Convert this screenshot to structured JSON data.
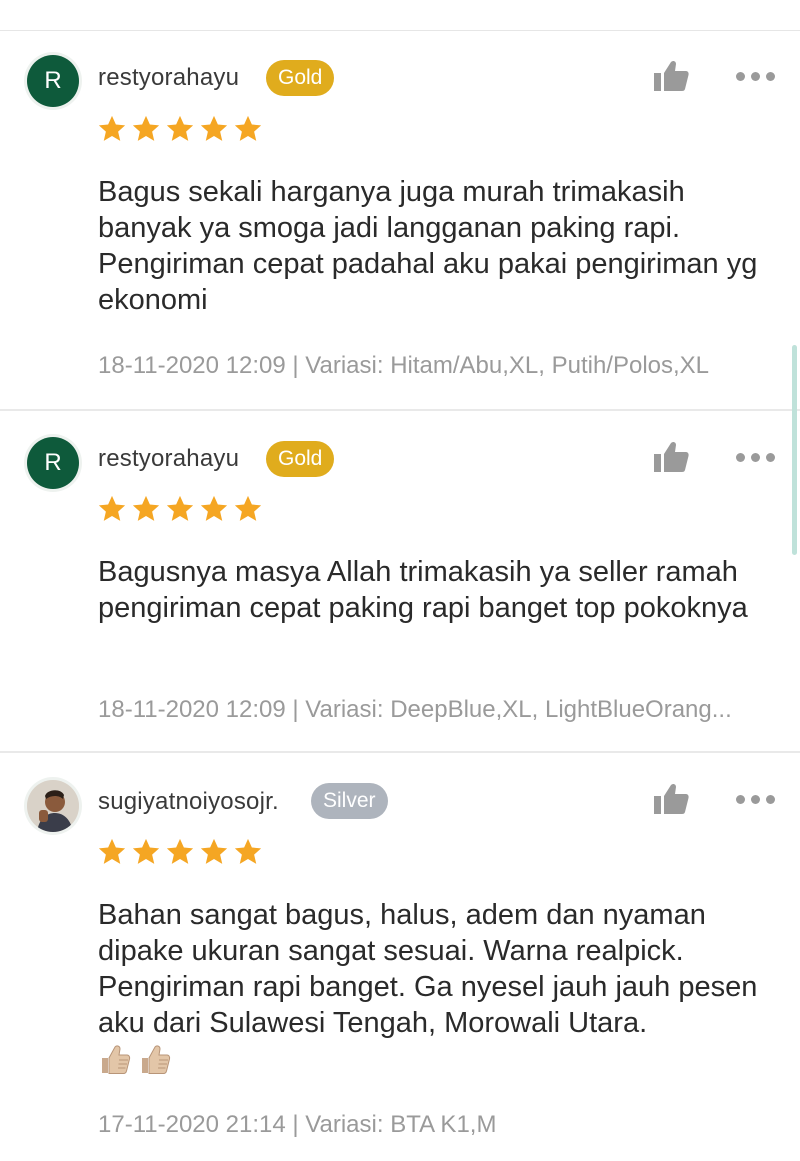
{
  "reviews": [
    {
      "avatar_letter": "R",
      "username": "restyorahayu",
      "badge": "Gold",
      "rating": 5,
      "text": "Bagus sekali harganya juga murah trimakasih banyak ya smoga jadi langganan paking rapi. Pengiriman cepat padahal aku pakai pengiriman yg ekonomi",
      "meta": "18-11-2020 12:09 | Variasi: Hitam/Abu,XL, Putih/Polos,XL"
    },
    {
      "avatar_letter": "R",
      "username": "restyorahayu",
      "badge": "Gold",
      "rating": 5,
      "text": "Bagusnya masya Allah trimakasih ya seller ramah pengiriman cepat paking rapi banget top pokoknya",
      "meta": "18-11-2020 12:09 | Variasi: DeepBlue,XL, LightBlueOrang..."
    },
    {
      "avatar_letter": "",
      "username": "sugiyatnoiyosojr.",
      "badge": "Silver",
      "rating": 5,
      "text": "Bahan sangat bagus, halus, adem dan nyaman dipake ukuran sangat sesuai. Warna realpick. Pengiriman rapi banget. Ga nyesel jauh jauh pesen aku dari Sulawesi Tengah, Morowali Utara.",
      "meta": "17-11-2020 21:14 | Variasi: BTA K1,M"
    }
  ],
  "icons": {
    "like": "thumbs-up-icon",
    "more": "more-dots-icon",
    "star": "star-icon"
  },
  "colors": {
    "gold_badge": "#e0ac1d",
    "silver_badge": "#aeb4bd",
    "star": "#f5a623",
    "avatar": "#0e5a3b"
  }
}
